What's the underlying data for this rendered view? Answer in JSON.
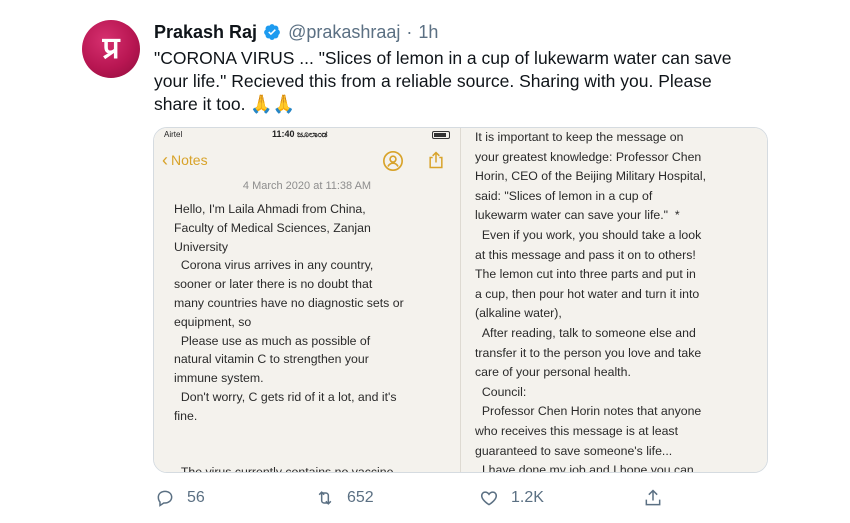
{
  "tweet": {
    "avatar_initial": "प्र",
    "name": "Prakash Raj",
    "handle": "@prakashraaj",
    "separator": "·",
    "time": "1h",
    "text_main": "\"CORONA VIRUS ... \"Slices of lemon in a cup of lukewarm water can save your life.\"  Recieved this from a reliable source. Sharing with you. Please share it too. ",
    "emoji": "🙏🙏"
  },
  "media": {
    "status": {
      "carrier": "Airtel",
      "clock": "11:40 ಜೂಲಾಂಡ"
    },
    "notes_back_label": "Notes",
    "note_date": "4 March 2020 at 11:38 AM",
    "note_left": "Hello, I'm Laila Ahmadi from China,\nFaculty of Medical Sciences, Zanjan\nUniversity\n  Corona virus arrives in any country,\nsooner or later there is no doubt that\nmany countries have no diagnostic sets or\nequipment, so\n  Please use as much as possible of\nnatural vitamin C to strengthen your\nimmune system.\n  Don't worry, C gets rid of it a lot, and it's\nfine.\n\n\n  The virus currently contains no vaccine",
    "note_right": "It is important to keep the message on\nyour greatest knowledge: Professor Chen\nHorin, CEO of the Beijing Military Hospital,\nsaid: \"Slices of lemon in a cup of\nlukewarm water can save your life.\"  *\n  Even if you work, you should take a look\nat this message and pass it on to others!\nThe lemon cut into three parts and put in\na cup, then pour hot water and turn it into\n(alkaline water),\n  After reading, talk to someone else and\ntransfer it to the person you love and take\ncare of your personal health.\n  Council:\n  Professor Chen Horin notes that anyone\nwho receives this message is at least\nguaranteed to save someone's life...\n  I have done my job and I hope you can"
  },
  "actions": {
    "replies": "56",
    "retweets": "652",
    "likes": "1.2K"
  },
  "colors": {
    "verified": "#1d9bf0",
    "notes_accent": "#d8a32a",
    "secondary_text": "#5b7083"
  }
}
